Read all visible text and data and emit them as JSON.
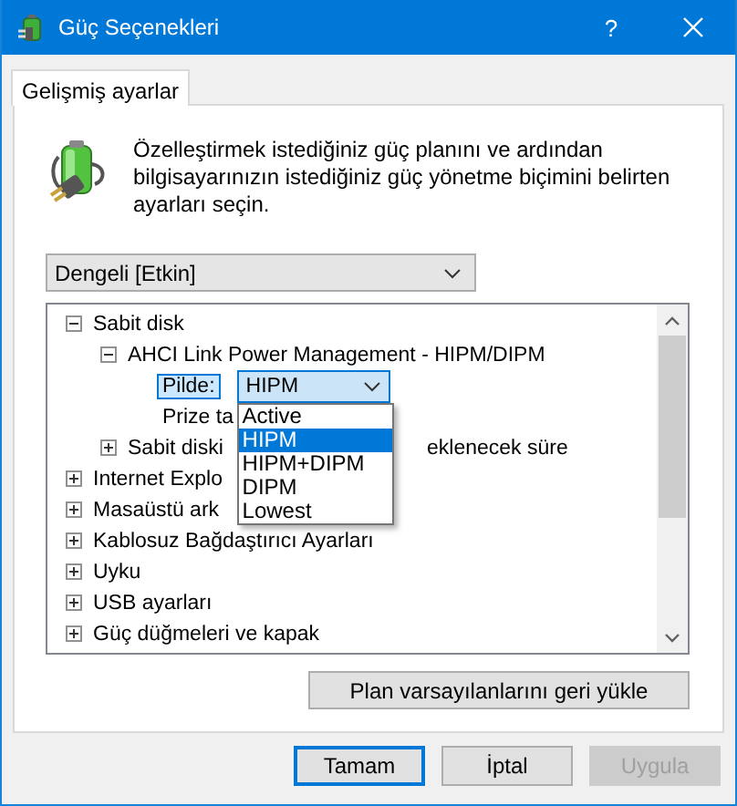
{
  "window": {
    "title": "Güç Seçenekleri",
    "help_glyph": "?"
  },
  "tabs": [
    {
      "label": "Gelişmiş ayarlar",
      "selected": true
    }
  ],
  "description": "Özelleştirmek istediğiniz güç planını ve ardından bilgisayarınızın istediğiniz güç yönetme biçimini belirten ayarları seçin.",
  "plan_select": {
    "value": "Dengeli [Etkin]"
  },
  "tree": [
    {
      "kind": "group",
      "label": "Sabit disk",
      "expanded": true,
      "children": [
        {
          "kind": "group",
          "label": "AHCI Link Power Management - HIPM/DIPM",
          "expanded": true,
          "children": [
            {
              "kind": "setting",
              "label": "Pilde:",
              "value": "HIPM",
              "selected": true,
              "options": [
                {
                  "label": "Active",
                  "selected": false
                },
                {
                  "label": "HIPM",
                  "selected": true
                },
                {
                  "label": "HIPM+DIPM",
                  "selected": false
                },
                {
                  "label": "DIPM",
                  "selected": false
                },
                {
                  "label": "Lowest",
                  "selected": false
                }
              ]
            },
            {
              "kind": "leaf",
              "label": "Prize ta"
            }
          ]
        },
        {
          "kind": "group",
          "label": "Sabit diski",
          "label_tail": "eklenecek süre",
          "expanded": false
        }
      ]
    },
    {
      "kind": "group",
      "label": "Internet Explo",
      "expanded": false
    },
    {
      "kind": "group",
      "label": "Masaüstü ark",
      "expanded": false
    },
    {
      "kind": "group",
      "label": "Kablosuz Bağdaştırıcı Ayarları",
      "expanded": false
    },
    {
      "kind": "group",
      "label": "Uyku",
      "expanded": false
    },
    {
      "kind": "group",
      "label": "USB ayarları",
      "expanded": false
    },
    {
      "kind": "group",
      "label": "Güç düğmeleri ve kapak",
      "expanded": false
    }
  ],
  "restore_button": {
    "label": "Plan varsayılanlarını geri yükle"
  },
  "buttons": [
    {
      "label": "Tamam",
      "default": true,
      "disabled": false
    },
    {
      "label": "İptal",
      "default": false,
      "disabled": false
    },
    {
      "label": "Uygula",
      "default": false,
      "disabled": true
    }
  ]
}
